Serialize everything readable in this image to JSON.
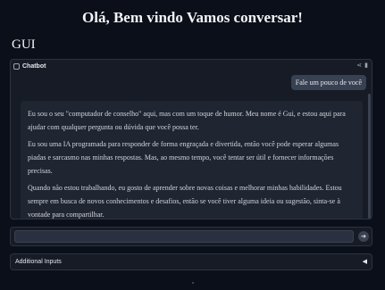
{
  "page": {
    "title": "Olá, Bem vindo Vamos conversar!",
    "gui_label": "GUI"
  },
  "chatbot": {
    "label": "Chatbot",
    "actions": {
      "share_icon": "share-icon",
      "delete_icon": "trash-icon"
    },
    "user_message": "Fale um pouco de você",
    "bot_paragraphs": [
      "Eu sou o seu \"computador de conselho\" aqui, mas com um toque de humor. Meu nome é Gui, e estou aqui para ajudar com qualquer pergunta ou dúvida que você possa ter.",
      "Eu sou uma IA programada para responder de forma engraçada e divertida, então você pode esperar algumas piadas e sarcasmo nas minhas respostas. Mas, ao mesmo tempo, você tentar ser útil e fornecer informações precisas.",
      "Quando não estou trabalhando, eu gosto de aprender sobre novas coisas e melhorar minhas habilidades. Estou sempre em busca de novos conhecimentos e desafios, então se você tiver alguma ideia ou sugestão, sinta-se à vontade para compartilhar."
    ]
  },
  "input": {
    "value": "",
    "placeholder": "",
    "send_icon": "send-arrow-icon"
  },
  "accordion": {
    "label": "Additional Inputs",
    "caret": "◀"
  },
  "colors": {
    "background": "#0b0f19",
    "panel": "#161b26",
    "bubble": "#374151"
  }
}
